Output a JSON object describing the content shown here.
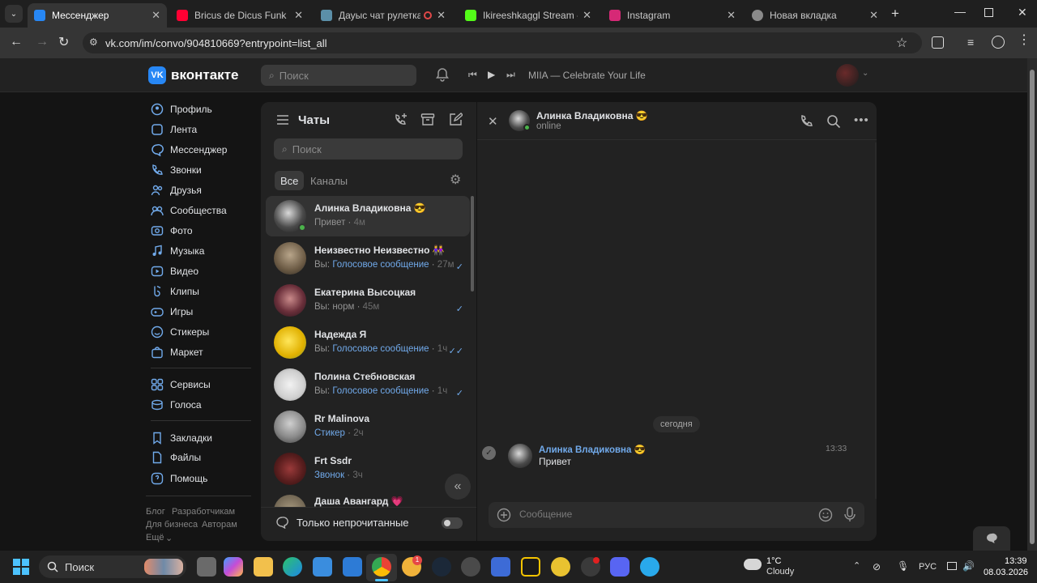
{
  "browser": {
    "tabs": [
      {
        "title": "Мессенджер",
        "active": true,
        "color": "#2787f5"
      },
      {
        "title": "Bricus de Dicus Funk - You",
        "active": false,
        "color": "#ff0033"
      },
      {
        "title": "Дауыс чат рулеткасы",
        "active": false,
        "color": "#5b8fa8"
      },
      {
        "title": "Ikireeshkaggl Stream - Wa",
        "active": false,
        "color": "#53fc18"
      },
      {
        "title": "Instagram",
        "active": false,
        "color": "#d62976"
      },
      {
        "title": "Новая вкладка",
        "active": false,
        "color": "#8a8a8a"
      }
    ],
    "url": "vk.com/im/convo/904810669?entrypoint=list_all"
  },
  "vk": {
    "logo_text": "вконтакте",
    "search_placeholder": "Поиск",
    "player_track": "MIIA — Celebrate Your Life",
    "menu": [
      {
        "label": "Профиль",
        "icon": "profile-icon"
      },
      {
        "label": "Лента",
        "icon": "feed-icon"
      },
      {
        "label": "Мессенджер",
        "icon": "messenger-icon"
      },
      {
        "label": "Звонки",
        "icon": "calls-icon"
      },
      {
        "label": "Друзья",
        "icon": "friends-icon"
      },
      {
        "label": "Сообщества",
        "icon": "communities-icon"
      },
      {
        "label": "Фото",
        "icon": "photo-icon"
      },
      {
        "label": "Музыка",
        "icon": "music-icon"
      },
      {
        "label": "Видео",
        "icon": "video-icon"
      },
      {
        "label": "Клипы",
        "icon": "clips-icon"
      },
      {
        "label": "Игры",
        "icon": "games-icon"
      },
      {
        "label": "Стикеры",
        "icon": "stickers-icon"
      },
      {
        "label": "Маркет",
        "icon": "market-icon"
      },
      {
        "label": "Сервисы",
        "icon": "services-icon"
      },
      {
        "label": "Голоса",
        "icon": "votes-icon"
      },
      {
        "label": "Закладки",
        "icon": "bookmarks-icon"
      },
      {
        "label": "Файлы",
        "icon": "files-icon"
      },
      {
        "label": "Помощь",
        "icon": "help-icon"
      }
    ],
    "footer": {
      "blog": "Блог",
      "developers": "Разработчикам",
      "business": "Для бизнеса",
      "authors": "Авторам",
      "more": "Ещё"
    }
  },
  "chats": {
    "title": "Чаты",
    "search_placeholder": "Поиск",
    "tab_all": "Все",
    "tab_channels": "Каналы",
    "unread_only": "Только непрочитанные",
    "items": [
      {
        "name": "Алинка Владиковна 😎",
        "preview": "Привет",
        "time": "4м",
        "active": true
      },
      {
        "name": "Неизвестно Неизвестно 👭",
        "prefix": "Вы: ",
        "preview": "Голосовое сообщение",
        "time": "27м",
        "check": "✓"
      },
      {
        "name": "Екатерина Высоцкая",
        "prefix": "Вы: ",
        "preview": "норм",
        "time": "45м",
        "check": "✓"
      },
      {
        "name": "Надежда Я",
        "prefix": "Вы: ",
        "preview": "Голосовое сообщение",
        "time": "1ч",
        "check": "✓✓"
      },
      {
        "name": "Полина Стебновская",
        "prefix": "Вы: ",
        "preview": "Голосовое сообщение",
        "time": "1ч",
        "check": "✓"
      },
      {
        "name": "Rr Malinova",
        "preview": "Стикер",
        "time": "2ч"
      },
      {
        "name": "Frt Ssdr",
        "preview": "Звонок",
        "time": "3ч"
      },
      {
        "name": "Даша Авангард 💗",
        "preview": "",
        "time": ""
      }
    ]
  },
  "convo": {
    "name": "Алинка Владиковна 😎",
    "status": "online",
    "date_divider": "сегодня",
    "message": {
      "author": "Алинка Владиковна 😎",
      "text": "Привет",
      "time": "13:33"
    },
    "input_placeholder": "Сообщение"
  },
  "taskbar": {
    "search_label": "Поиск",
    "weather_temp": "1°C",
    "weather_desc": "Cloudy",
    "lang": "РУС",
    "time": "13:39",
    "date": "08.03.2026",
    "badge_count": "1"
  }
}
